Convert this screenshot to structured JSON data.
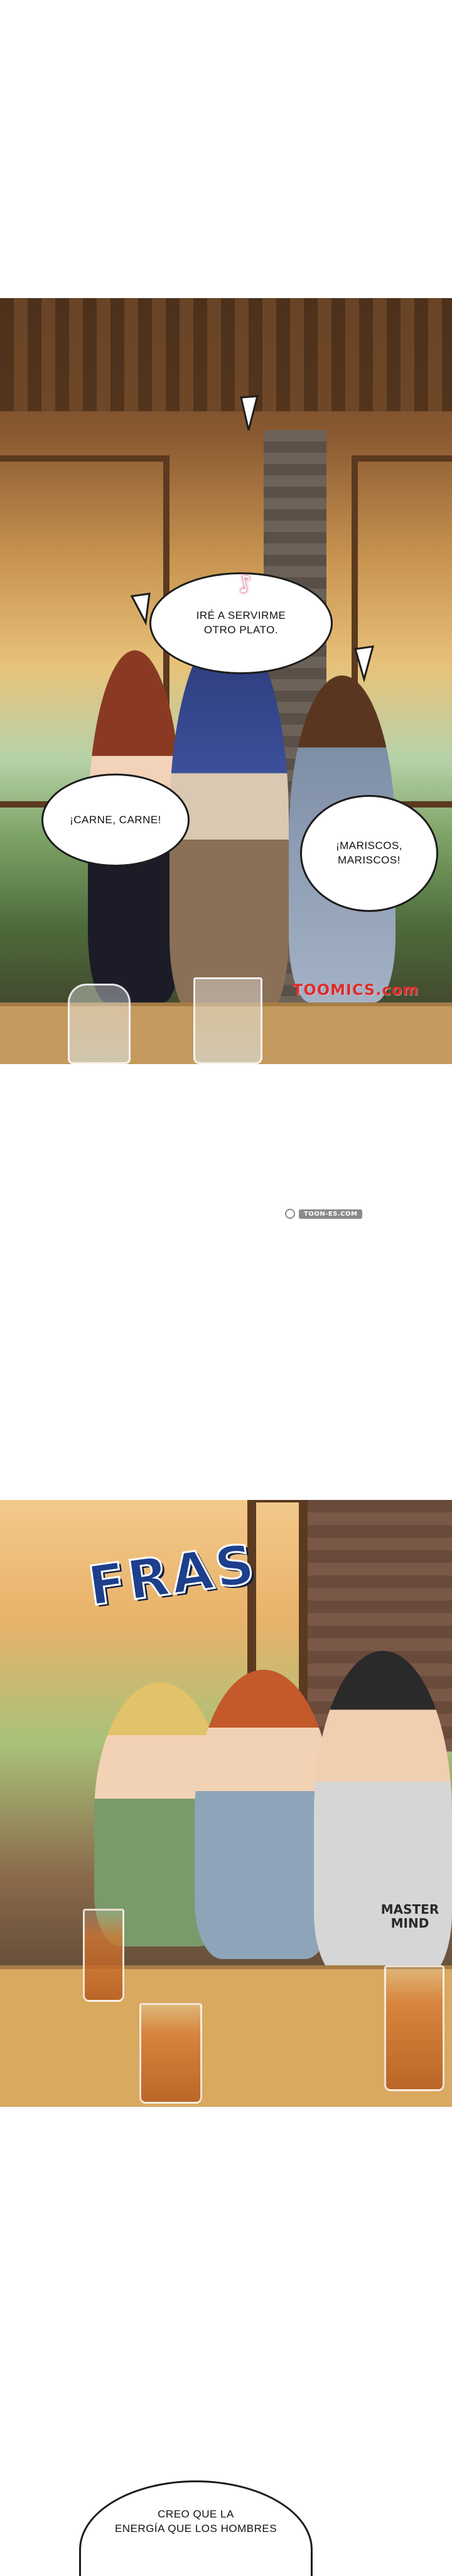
{
  "panel_1": {
    "bubbles": {
      "top": "IRÉ A SERVIRME\nOTRO PLATO.",
      "left": "¡CARNE, CARNE!",
      "right": "¡MARISCOS,\nMARISCOS!"
    },
    "music_note": "♪",
    "watermark": "TOOMICS.com"
  },
  "separator_badge": "TOON-ES.COM",
  "panel_2": {
    "sfx": "FRAS",
    "shirt_text": "MASTER\nMIND"
  },
  "bottom_bubble": "CREO QUE LA\nENERGÍA QUE LOS HOMBRES",
  "colors": {
    "sfx_fill": "#1d3f8c",
    "watermark_red": "#e02a2a",
    "bubble_border": "#1c1c1c"
  }
}
